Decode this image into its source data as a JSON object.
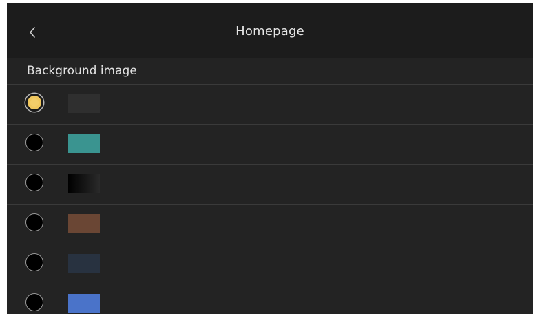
{
  "header": {
    "title": "Homepage",
    "back_icon": "chevron-left-icon"
  },
  "section": {
    "label": "Background image"
  },
  "options": [
    {
      "selected": true,
      "color": "#2f2f2f",
      "color_end": "#2f2f2f"
    },
    {
      "selected": false,
      "color": "#3a9490",
      "color_end": "#3a9490"
    },
    {
      "selected": false,
      "color": "#000000",
      "color_end": "#2a2a2a"
    },
    {
      "selected": false,
      "color": "#6a4634",
      "color_end": "#6a4634"
    },
    {
      "selected": false,
      "color": "#283240",
      "color_end": "#283240"
    },
    {
      "selected": false,
      "color": "#4a73c9",
      "color_end": "#4a73c9"
    }
  ],
  "colors": {
    "selected_accent": "#f0c75e",
    "background": "#232323",
    "header": "#1c1c1c"
  }
}
